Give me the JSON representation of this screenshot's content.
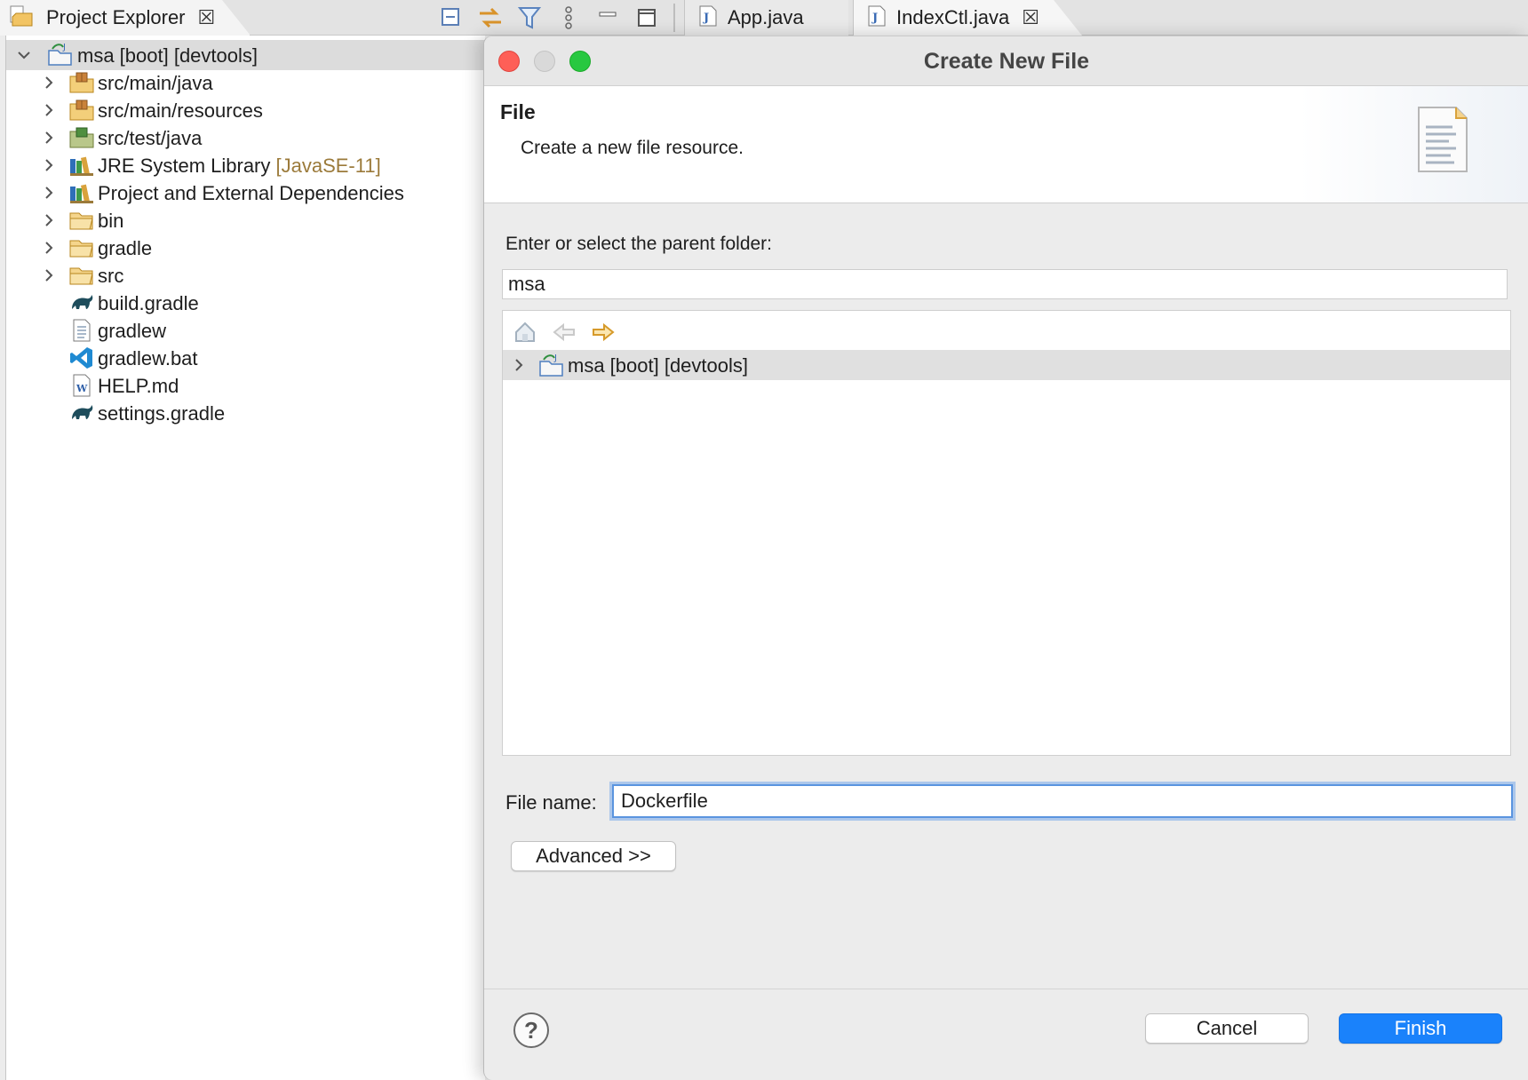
{
  "explorer": {
    "title": "Project Explorer",
    "project": {
      "label": "msa [boot] [devtools]"
    },
    "items": [
      {
        "label": "src/main/java",
        "decoration": "",
        "icon": "source-folder-icon",
        "expandable": true
      },
      {
        "label": "src/main/resources",
        "decoration": "",
        "icon": "source-folder-icon",
        "expandable": true
      },
      {
        "label": "src/test/java",
        "decoration": "",
        "icon": "test-source-folder-icon",
        "expandable": true
      },
      {
        "label": "JRE System Library ",
        "decoration": "[JavaSE-11]",
        "icon": "library-icon",
        "expandable": true
      },
      {
        "label": "Project and External Dependencies",
        "decoration": "",
        "icon": "library-icon",
        "expandable": true
      },
      {
        "label": "bin",
        "decoration": "",
        "icon": "folder-icon",
        "expandable": true
      },
      {
        "label": "gradle",
        "decoration": "",
        "icon": "folder-icon",
        "expandable": true
      },
      {
        "label": "src",
        "decoration": "",
        "icon": "folder-icon",
        "expandable": true
      },
      {
        "label": "build.gradle",
        "decoration": "",
        "icon": "gradle-file-icon",
        "expandable": false
      },
      {
        "label": "gradlew",
        "decoration": "",
        "icon": "text-file-icon",
        "expandable": false
      },
      {
        "label": "gradlew.bat",
        "decoration": "",
        "icon": "vscode-file-icon",
        "expandable": false
      },
      {
        "label": "HELP.md",
        "decoration": "",
        "icon": "word-file-icon",
        "expandable": false
      },
      {
        "label": "settings.gradle",
        "decoration": "",
        "icon": "gradle-file-icon",
        "expandable": false
      }
    ]
  },
  "editor_tabs": [
    {
      "label": "App.java",
      "icon": "java-file-icon"
    },
    {
      "label": "IndexCtl.java",
      "icon": "java-file-icon"
    }
  ],
  "dialog": {
    "title": "Create New File",
    "banner_title": "File",
    "banner_description": "Create a new file resource.",
    "parent_label": "Enter or select the parent folder:",
    "parent_value": "msa",
    "tree_root": "msa [boot] [devtools]",
    "file_name_label": "File name:",
    "file_name_value": "Dockerfile",
    "advanced_label": "Advanced >>",
    "cancel_label": "Cancel",
    "finish_label": "Finish",
    "help_symbol": "?"
  },
  "colors": {
    "accent": "#1a82fb",
    "focus_ring": "#5a94df",
    "traffic_close": "#fe5f57",
    "traffic_max": "#28c840"
  }
}
